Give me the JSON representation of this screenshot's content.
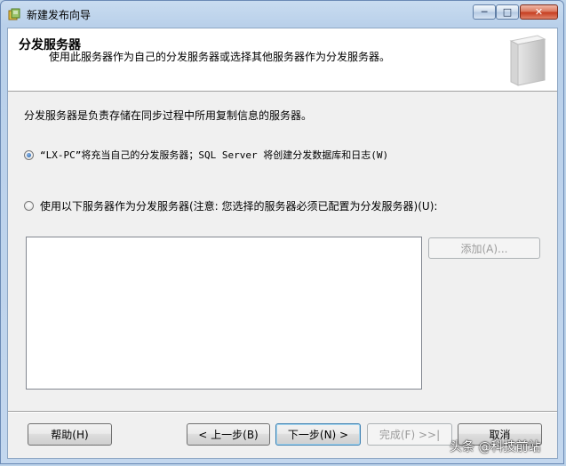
{
  "window": {
    "title": "新建发布向导",
    "minimize": "─",
    "maximize": "□",
    "close": "✕"
  },
  "header": {
    "title": "分发服务器",
    "description": "使用此服务器作为自己的分发服务器或选择其他服务器作为分发服务器。"
  },
  "body": {
    "description": "分发服务器是负责存储在同步过程中所用复制信息的服务器。",
    "option_self": {
      "label": "“LX-PC”将充当自己的分发服务器；SQL Server 将创建分发数据库和日志(W)",
      "checked": true
    },
    "option_other": {
      "label": "使用以下服务器作为分发服务器(注意: 您选择的服务器必须已配置为分发服务器)(U):",
      "checked": false
    },
    "server_list": [],
    "add_button": "添加(A)..."
  },
  "footer": {
    "help": "帮助(H)",
    "back": "< 上一步(B)",
    "next": "下一步(N) >",
    "finish": "完成(F) >>|",
    "cancel": "取消"
  },
  "watermark": "头条 @科技前站"
}
